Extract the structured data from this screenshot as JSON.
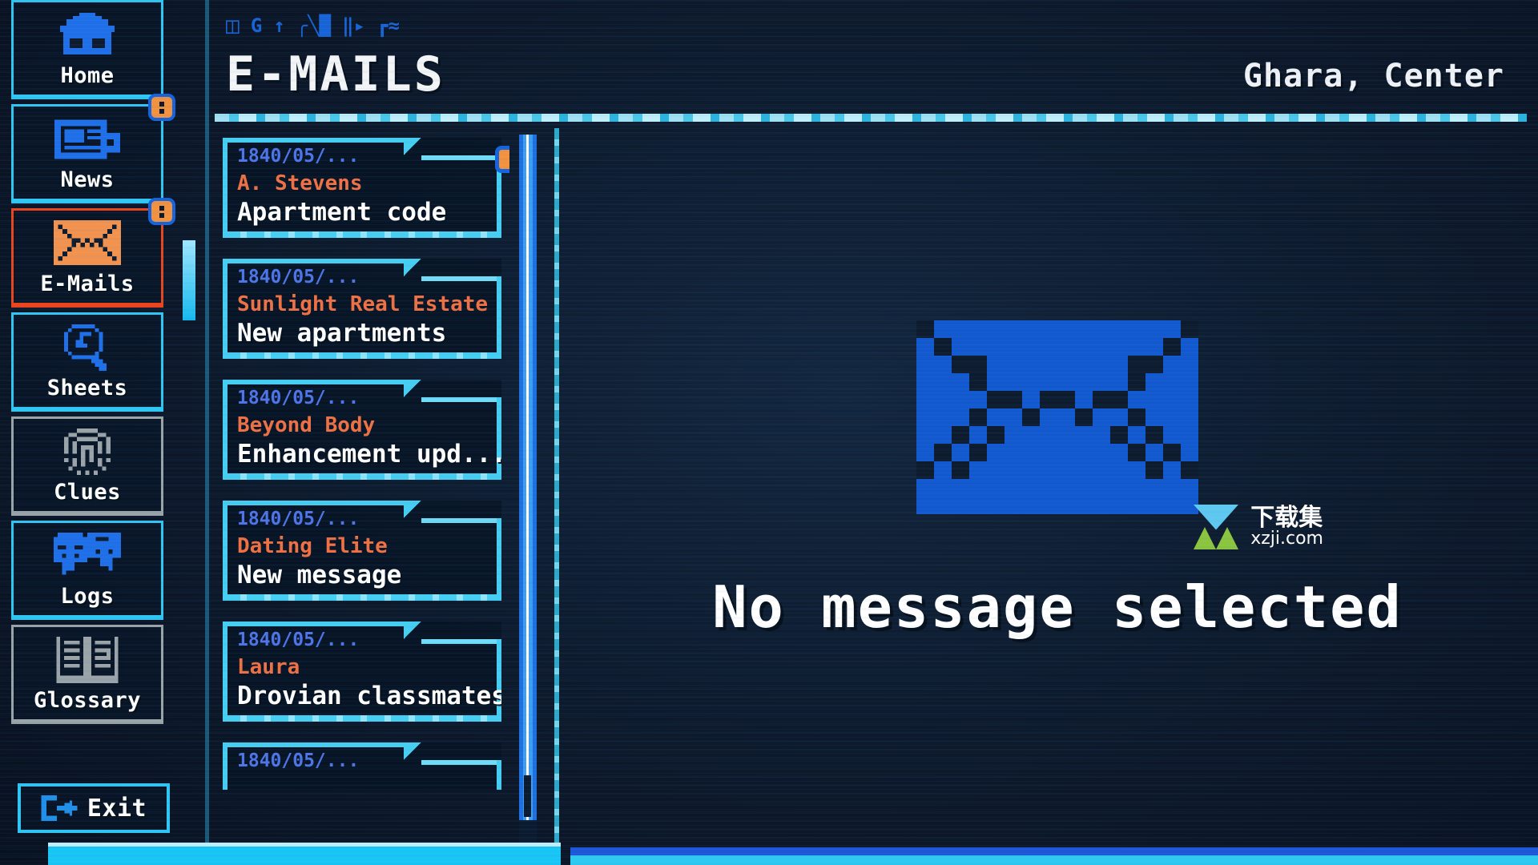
{
  "app": {
    "page_title": "E-MAILS",
    "location": "Ghara, Center"
  },
  "statusbar": {
    "icons": [
      "battery-icon",
      "refresh-icon",
      "arrow-up-icon",
      "signal-bars-icon",
      "network-icon",
      "wave-icon"
    ],
    "glyphs": [
      "▭",
      "G",
      "↑",
      "▂▄▆",
      "⫫",
      "≈"
    ]
  },
  "sidebar": {
    "items": [
      {
        "id": "home",
        "label": "Home",
        "icon": "house-icon",
        "state": "normal",
        "badge": null
      },
      {
        "id": "news",
        "label": "News",
        "icon": "newspaper-icon",
        "state": "normal",
        "badge": "unread"
      },
      {
        "id": "emails",
        "label": "E-Mails",
        "icon": "envelope-icon",
        "state": "active",
        "badge": "unread"
      },
      {
        "id": "sheets",
        "label": "Sheets",
        "icon": "magnifier-icon",
        "state": "normal",
        "badge": null
      },
      {
        "id": "clues",
        "label": "Clues",
        "icon": "fingerprint-icon",
        "state": "dim",
        "badge": null
      },
      {
        "id": "logs",
        "label": "Logs",
        "icon": "chat-bubbles-icon",
        "state": "normal",
        "badge": null
      },
      {
        "id": "glossary",
        "label": "Glossary",
        "icon": "open-book-icon",
        "state": "dim",
        "badge": null
      }
    ],
    "exit": {
      "label": "Exit",
      "icon": "exit-door-icon"
    }
  },
  "mail_list": {
    "items": [
      {
        "date": "1840/05/...",
        "sender": "A. Stevens",
        "subject": "Apartment code",
        "unread": true
      },
      {
        "date": "1840/05/...",
        "sender": "Sunlight Real Estate",
        "subject": "New apartments",
        "unread": false
      },
      {
        "date": "1840/05/...",
        "sender": "Beyond Body",
        "subject": "Enhancement upd...",
        "unread": false
      },
      {
        "date": "1840/05/...",
        "sender": "Dating Elite",
        "subject": "New message",
        "unread": false
      },
      {
        "date": "1840/05/...",
        "sender": "Laura",
        "subject": "Drovian classmates",
        "unread": false
      },
      {
        "date": "1840/05/...",
        "sender": "",
        "subject": "",
        "unread": false
      }
    ]
  },
  "main": {
    "empty_text": "No message selected",
    "empty_icon": "envelope-icon"
  },
  "watermark": {
    "cn": "下载集",
    "en": "xzji.com",
    "icon": "download-arrow-logo"
  },
  "colors": {
    "accent_cyan": "#2fc6f3",
    "accent_blue": "#1864d6",
    "accent_orange": "#ef7042",
    "active_red": "#e8451f",
    "badge_orange": "#f2923f",
    "dim_grey": "#9aa3a8",
    "bg_dark": "#0d1b2e",
    "text_white": "#ffffff",
    "date_blue": "#4d74e8"
  }
}
